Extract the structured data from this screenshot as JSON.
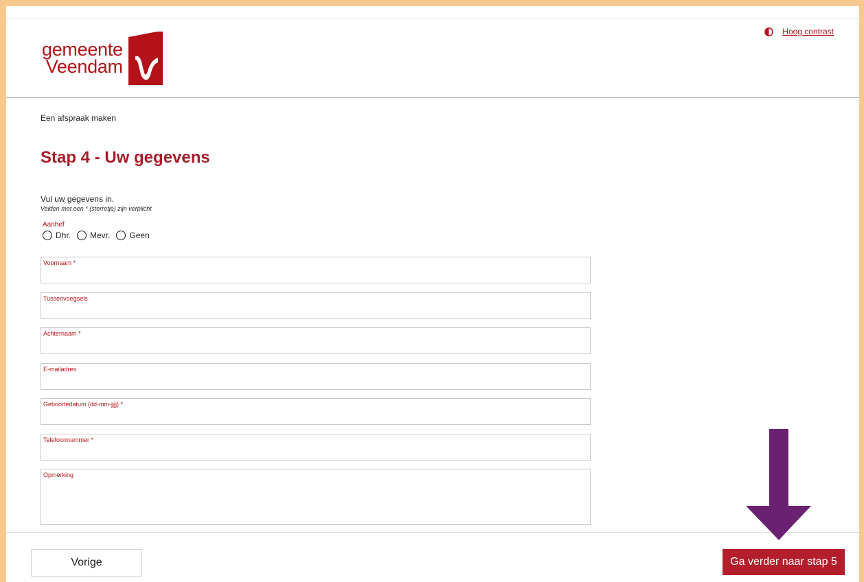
{
  "header": {
    "logo": {
      "line1": "gemeente",
      "line2": "Veendam"
    },
    "contrast_link": "Hoog contrast",
    "contrast_icon": "contrast-icon"
  },
  "page": {
    "breadcrumb": "Een afspraak maken",
    "title": "Stap 4 - Uw gegevens",
    "intro": "Vul uw gegevens in.",
    "required_note": "Velden met een * (sterretje) zijn verplicht"
  },
  "salutation": {
    "label": "Aanhef",
    "options": [
      "Dhr.",
      "Mevr.",
      "Geen"
    ]
  },
  "fields": {
    "first_name": {
      "label": "Voornaam *",
      "value": ""
    },
    "infix": {
      "label": "Tussenvoegsels",
      "value": ""
    },
    "last_name": {
      "label": "Achternaam *",
      "value": ""
    },
    "email": {
      "label": "E-mailadres",
      "value": ""
    },
    "birthdate": {
      "label": "Geboortedatum (dd-mm-jjjj) *",
      "value": ""
    },
    "phone": {
      "label": "Telefoonnummer *",
      "value": ""
    },
    "remark": {
      "label": "Opmerking",
      "value": ""
    }
  },
  "footer": {
    "prev_label": "Vorige",
    "next_label": "Ga verder naar stap 5"
  },
  "colors": {
    "brand": "#b41119",
    "title": "#a81d2b",
    "next_button": "#b41e2c",
    "frame": "#f8c98f",
    "arrow": "#6a2171"
  },
  "annotation": {
    "icon": "arrow-down-icon"
  }
}
